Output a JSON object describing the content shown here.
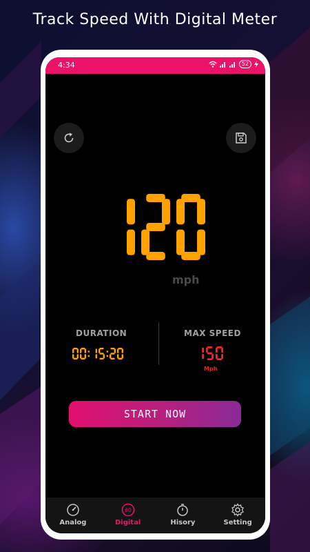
{
  "headline": "Track Speed With Digital Meter",
  "status_bar": {
    "time": "4:34",
    "battery": "52"
  },
  "speed": {
    "value": "120",
    "unit": "mph"
  },
  "duration": {
    "label": "DURATION",
    "value": "00:15:20"
  },
  "max_speed": {
    "label": "MAX SPEED",
    "value": "150",
    "unit": "Mph"
  },
  "start_button": {
    "label": "START NOW"
  },
  "nav": {
    "items": [
      {
        "label": "Analog",
        "icon": "gauge-icon"
      },
      {
        "label": "Digital",
        "icon": "digital-60-icon",
        "badge": "60",
        "active": true
      },
      {
        "label": "Hisory",
        "icon": "timer-icon"
      },
      {
        "label": "Setting",
        "icon": "gear-icon"
      }
    ]
  },
  "colors": {
    "accent_pink": "#ea1367",
    "speed_orange": "#ffa200",
    "max_red": "#ff2020",
    "button_gradient_end": "#8a2a97"
  }
}
